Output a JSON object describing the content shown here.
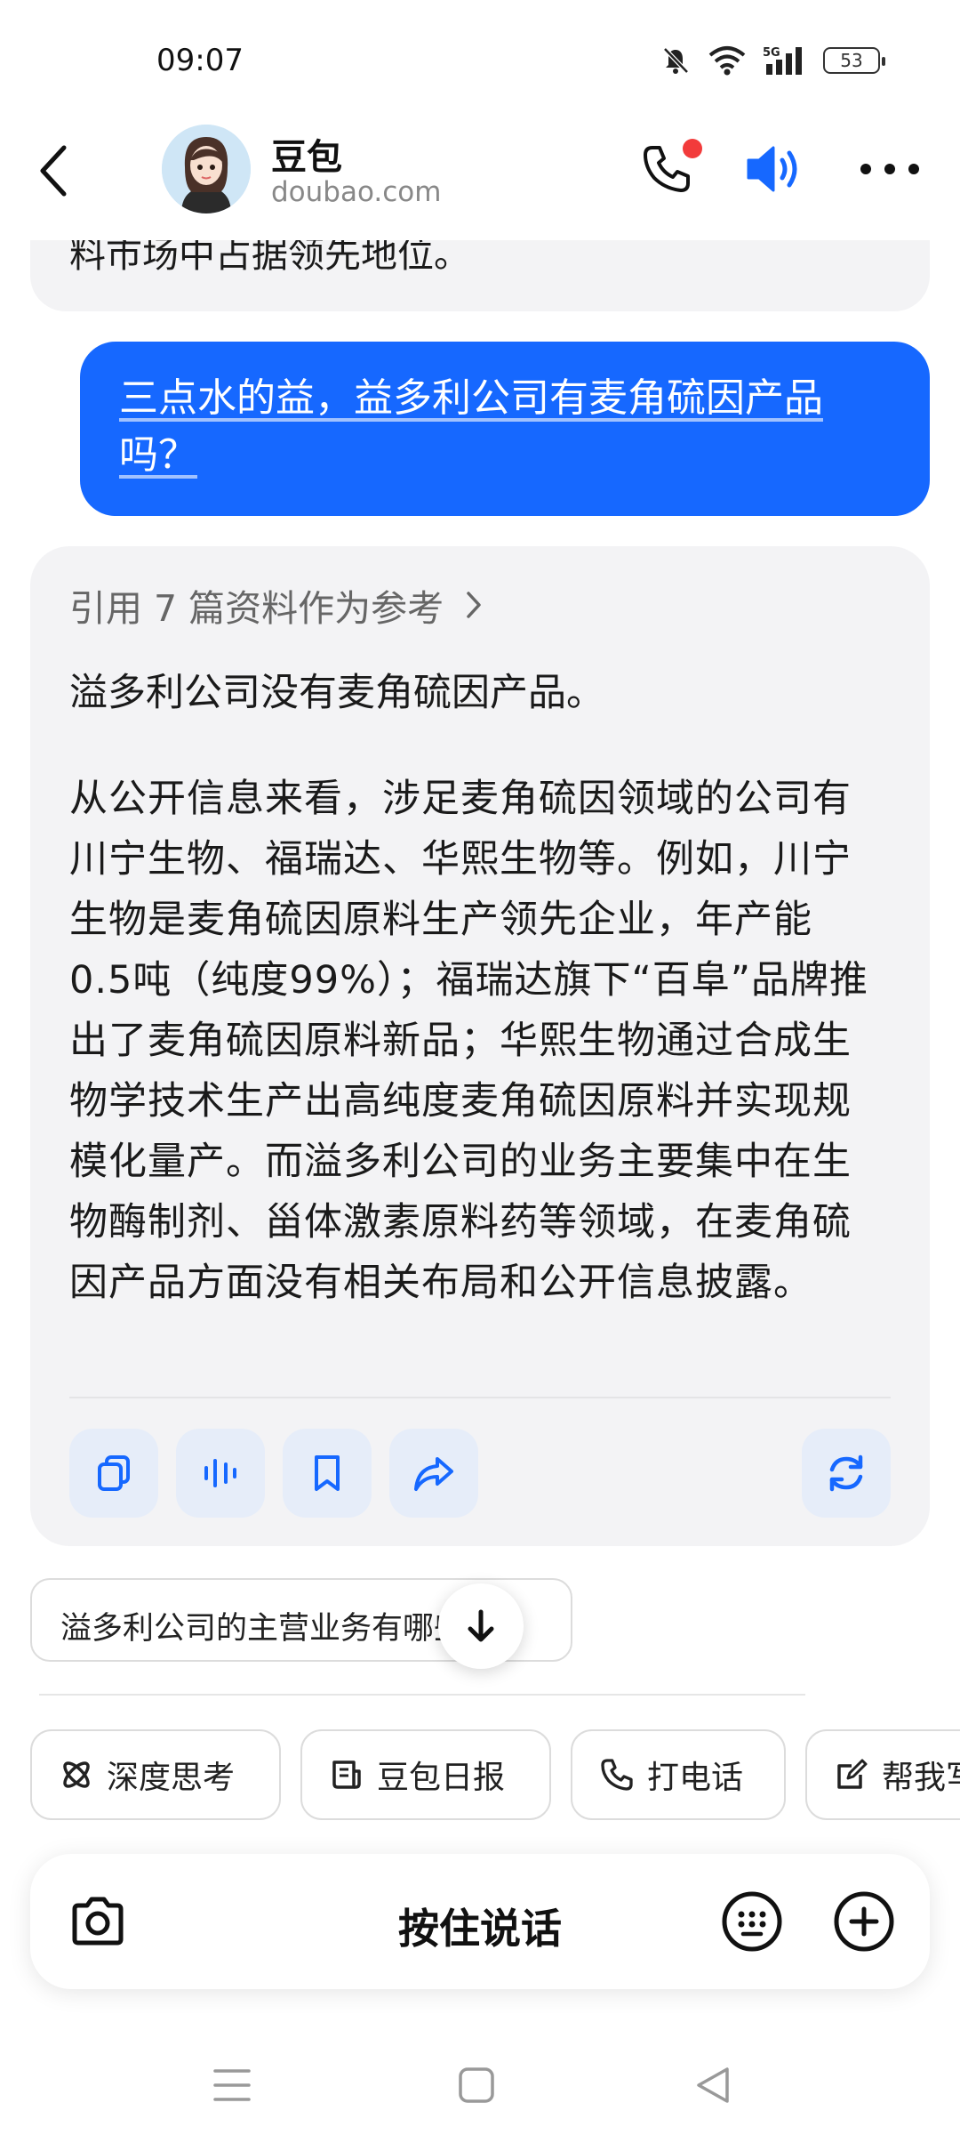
{
  "status_bar": {
    "time": "09:07",
    "network": "5G",
    "battery": "53"
  },
  "header": {
    "title": "豆包",
    "subtitle": "doubao.com"
  },
  "chat": {
    "previous_reply_tail": "料市场中占据领先地位。",
    "user_message": "三点水的益，益多利公司有麦角硫因产品吗？",
    "answer": {
      "references": "引用 7 篇资料作为参考",
      "first_line": "溢多利公司没有麦角硫因产品。",
      "paragraph": "从公开信息来看，涉足麦角硫因领域的公司有川宁生物、福瑞达、华熙生物等。例如，川宁生物是麦角硫因原料生产领先企业，年产能0.5吨（纯度99%）；福瑞达旗下“百阜”品牌推出了麦角硫因原料新品；华熙生物通过合成生物学技术生产出高纯度麦角硫因原料并实现规模化量产。而溢多利公司的业务主要集中在生物酶制剂、甾体激素原料药等领域，在麦角硫因产品方面没有相关布局和公开信息披露。"
    },
    "suggestion": "溢多利公司的主营业务有哪些？"
  },
  "chips": [
    {
      "label": "深度思考",
      "icon": "atom-icon"
    },
    {
      "label": "豆包日报",
      "icon": "newspaper-icon"
    },
    {
      "label": "打电话",
      "icon": "phone-icon"
    },
    {
      "label": "帮我写作",
      "icon": "edit-icon"
    }
  ],
  "input": {
    "hold_to_talk": "按住说话"
  },
  "colors": {
    "accent": "#1668ff",
    "bubble_bg": "#f3f3f5",
    "action_bg": "#e6edf9",
    "notification_dot": "#f23b3b"
  }
}
